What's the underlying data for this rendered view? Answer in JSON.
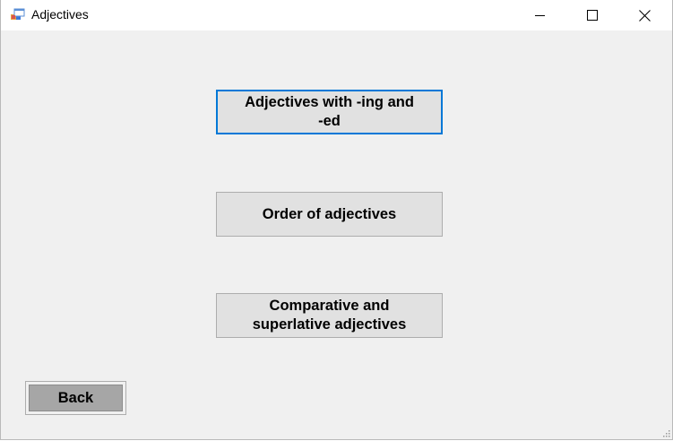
{
  "window": {
    "title": "Adjectives",
    "icon": "windows-forms-app-icon"
  },
  "titlebar_controls": {
    "minimize_icon": "minimize-icon",
    "maximize_icon": "maximize-icon",
    "close_icon": "close-icon"
  },
  "buttons": {
    "ing_ed_line1": "Adjectives with -ing and",
    "ing_ed_line2": "-ed",
    "order": "Order of adjectives",
    "comparative_line1": "Comparative and",
    "comparative_line2": "superlative adjectives",
    "back": "Back"
  },
  "colors": {
    "focus_border": "#0078d7",
    "button_face": "#e1e1e1",
    "back_button_face": "#a6a6a6",
    "client_background": "#f0f0f0"
  }
}
